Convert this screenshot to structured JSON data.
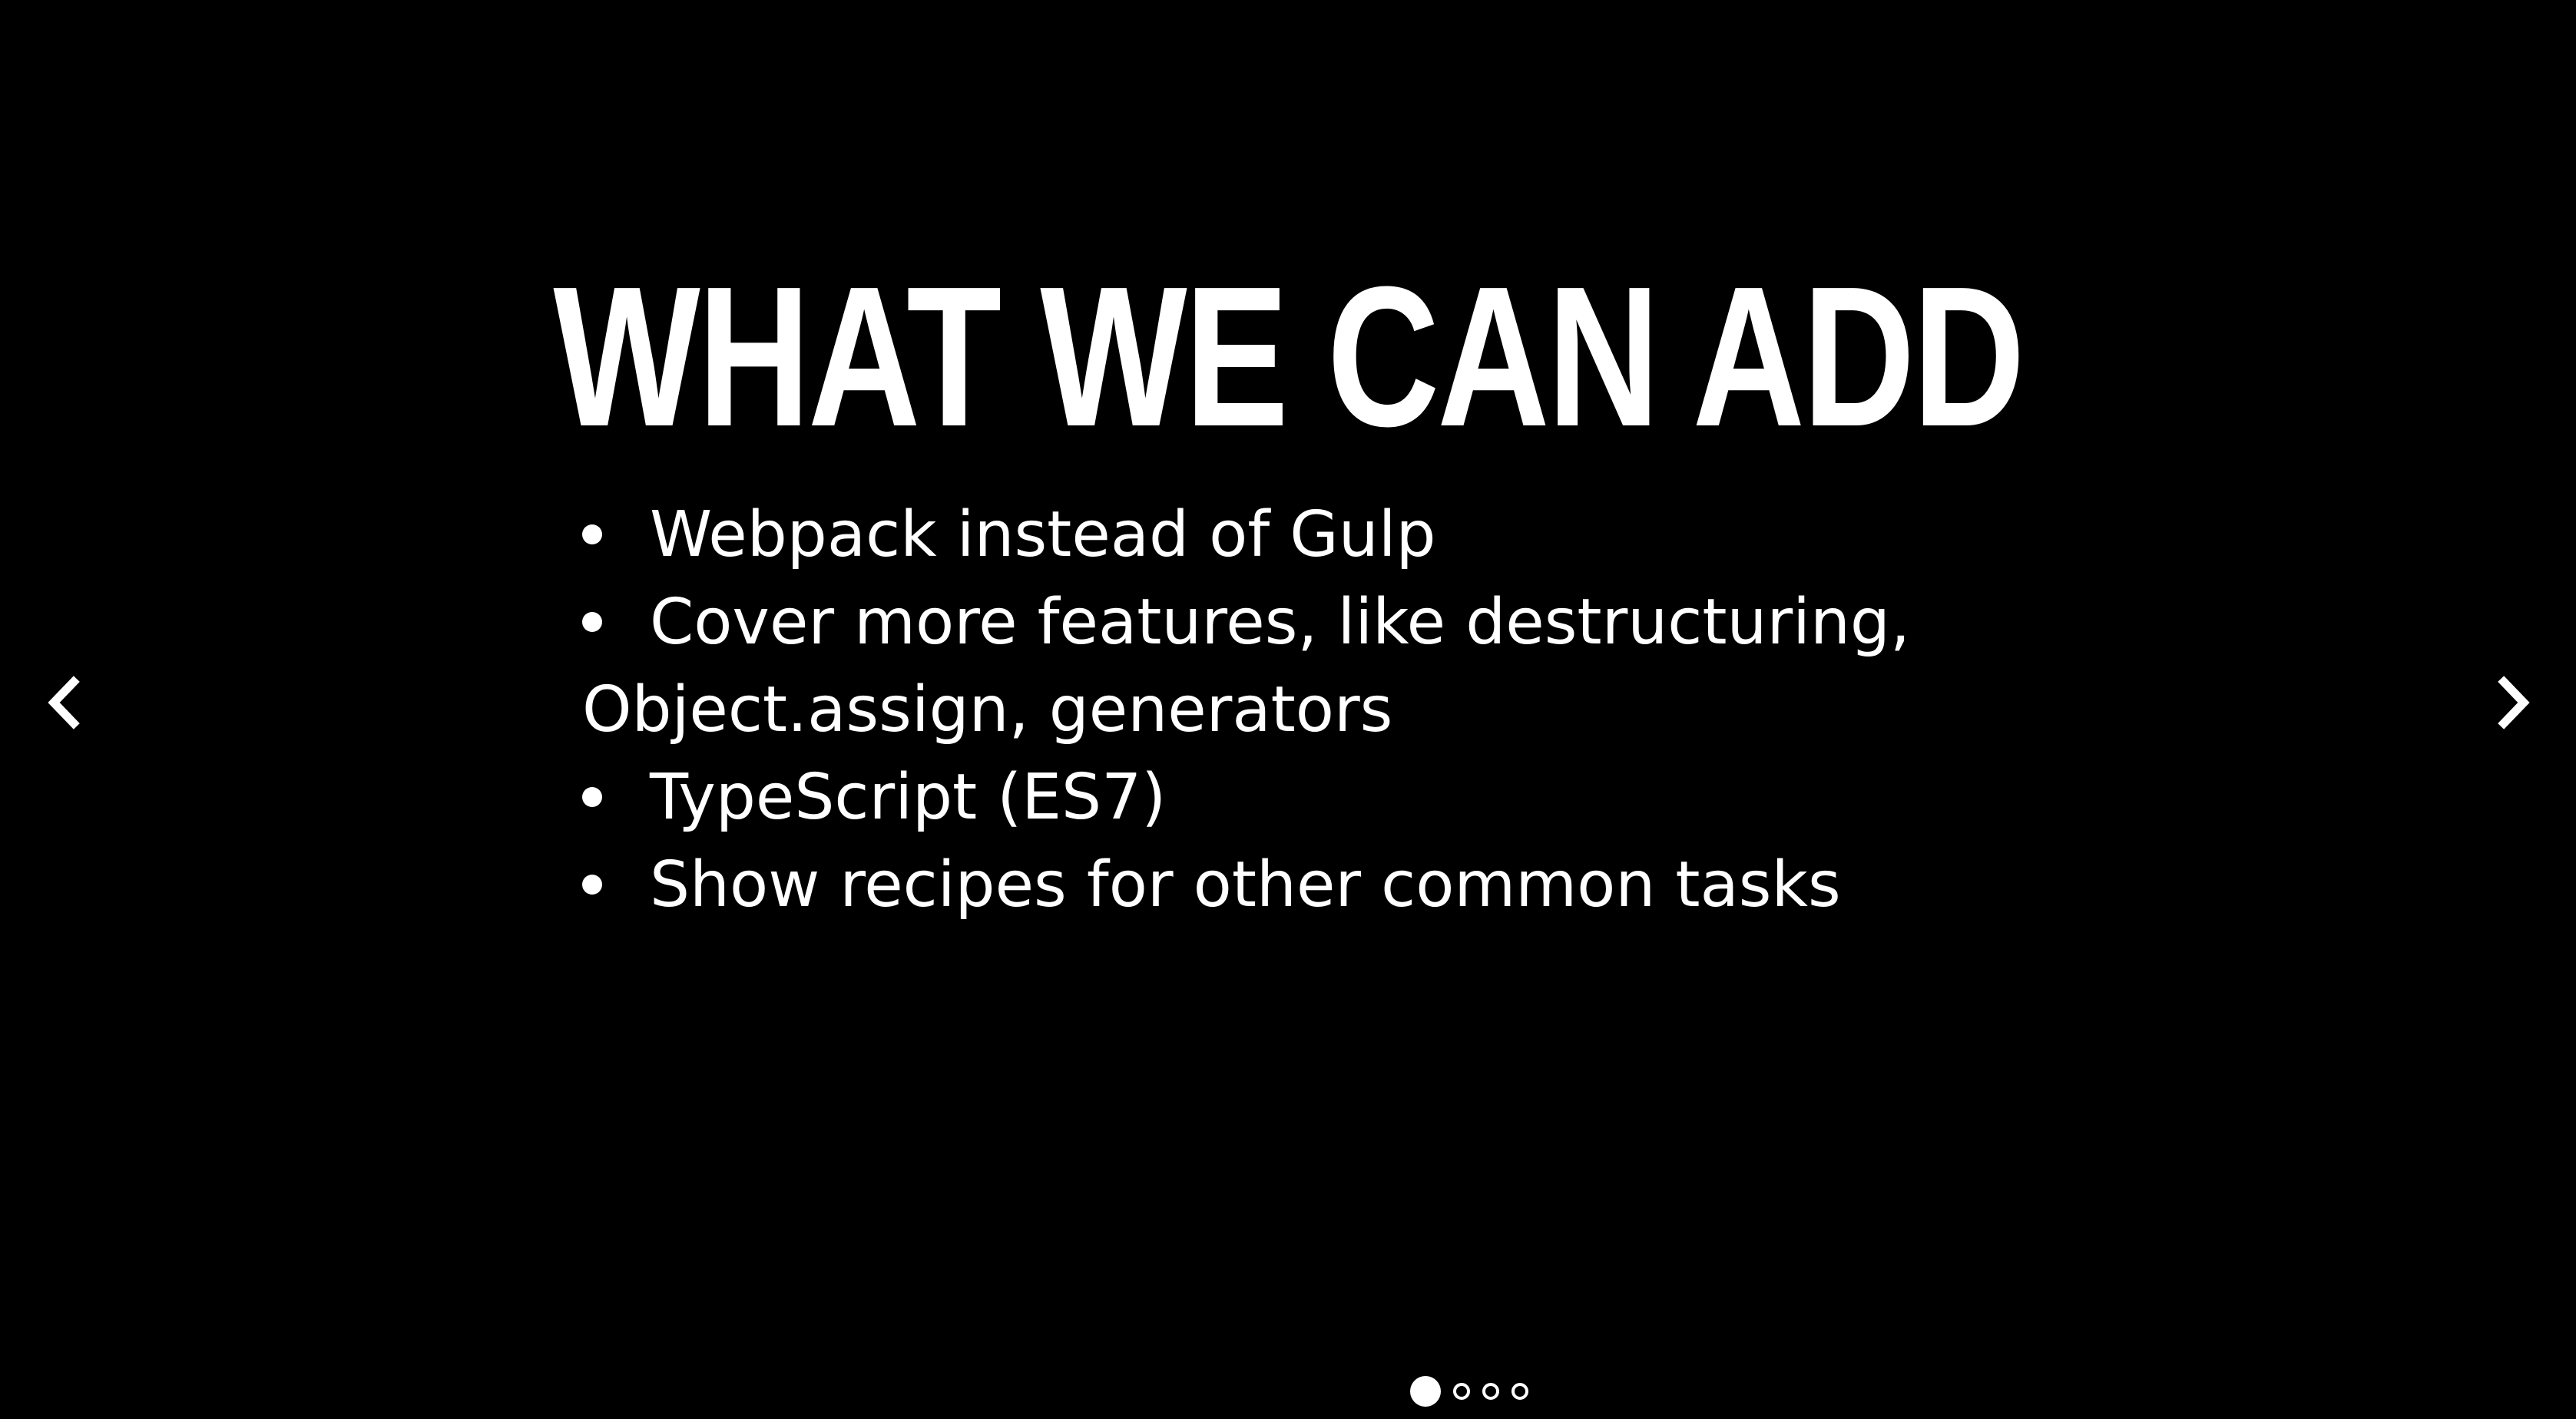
{
  "slide": {
    "title": "WHAT WE CAN ADD",
    "bullets": [
      {
        "text": "Webpack instead of Gulp"
      },
      {
        "text": "Cover more features, like destructuring,"
      },
      {
        "text": "Object.assign, generators"
      },
      {
        "text": "TypeScript (ES7)"
      },
      {
        "text": "Show recipes for other common tasks"
      }
    ]
  },
  "navigation": {
    "prev_icon": "chevron-left-icon",
    "next_icon": "chevron-right-icon"
  },
  "pager": {
    "total_slides": 4,
    "active_index": 0
  },
  "colors": {
    "background": "#000000",
    "foreground": "#ffffff"
  }
}
